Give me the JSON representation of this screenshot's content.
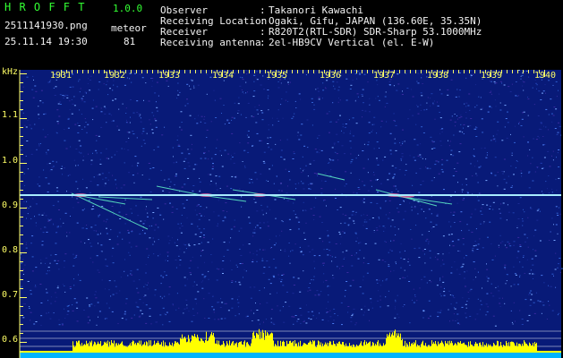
{
  "app": {
    "name": "H R O F F T",
    "version": "1.0.0"
  },
  "file": {
    "name": "2511141930.png",
    "timestamp": "25.11.14 19:30"
  },
  "detection": {
    "label": "meteor",
    "count": "81"
  },
  "info": [
    {
      "label": "Observer",
      "value": "Takanori Kawachi"
    },
    {
      "label": "Receiving Location",
      "value": "Ogaki, Gifu, JAPAN (136.60E, 35.35N)"
    },
    {
      "label": "Receiver",
      "value": "R820T2(RTL-SDR) SDR-Sharp 53.1000MHz"
    },
    {
      "label": "Receiving antenna",
      "value": "2el-HB9CV Vertical (el. E-W)"
    }
  ],
  "spectrogram": {
    "y_unit": "kHz",
    "y_ticks": [
      "1.1",
      "1.0",
      "0.9",
      "0.8",
      "0.7",
      "0.6"
    ],
    "x_ticks": [
      "1931",
      "1932",
      "1933",
      "1934",
      "1935",
      "1936",
      "1937",
      "1938",
      "1939",
      "1940"
    ]
  },
  "colors": {
    "background": "#000000",
    "plot_noise": "#0a1a78",
    "carrier": "#9fe6ff",
    "meteor_echo": "#66ffcc",
    "label_green": "#33ff33",
    "label_yellow": "#ffff66",
    "level_bar": "#ffff00",
    "floor": "#00b4ff"
  }
}
